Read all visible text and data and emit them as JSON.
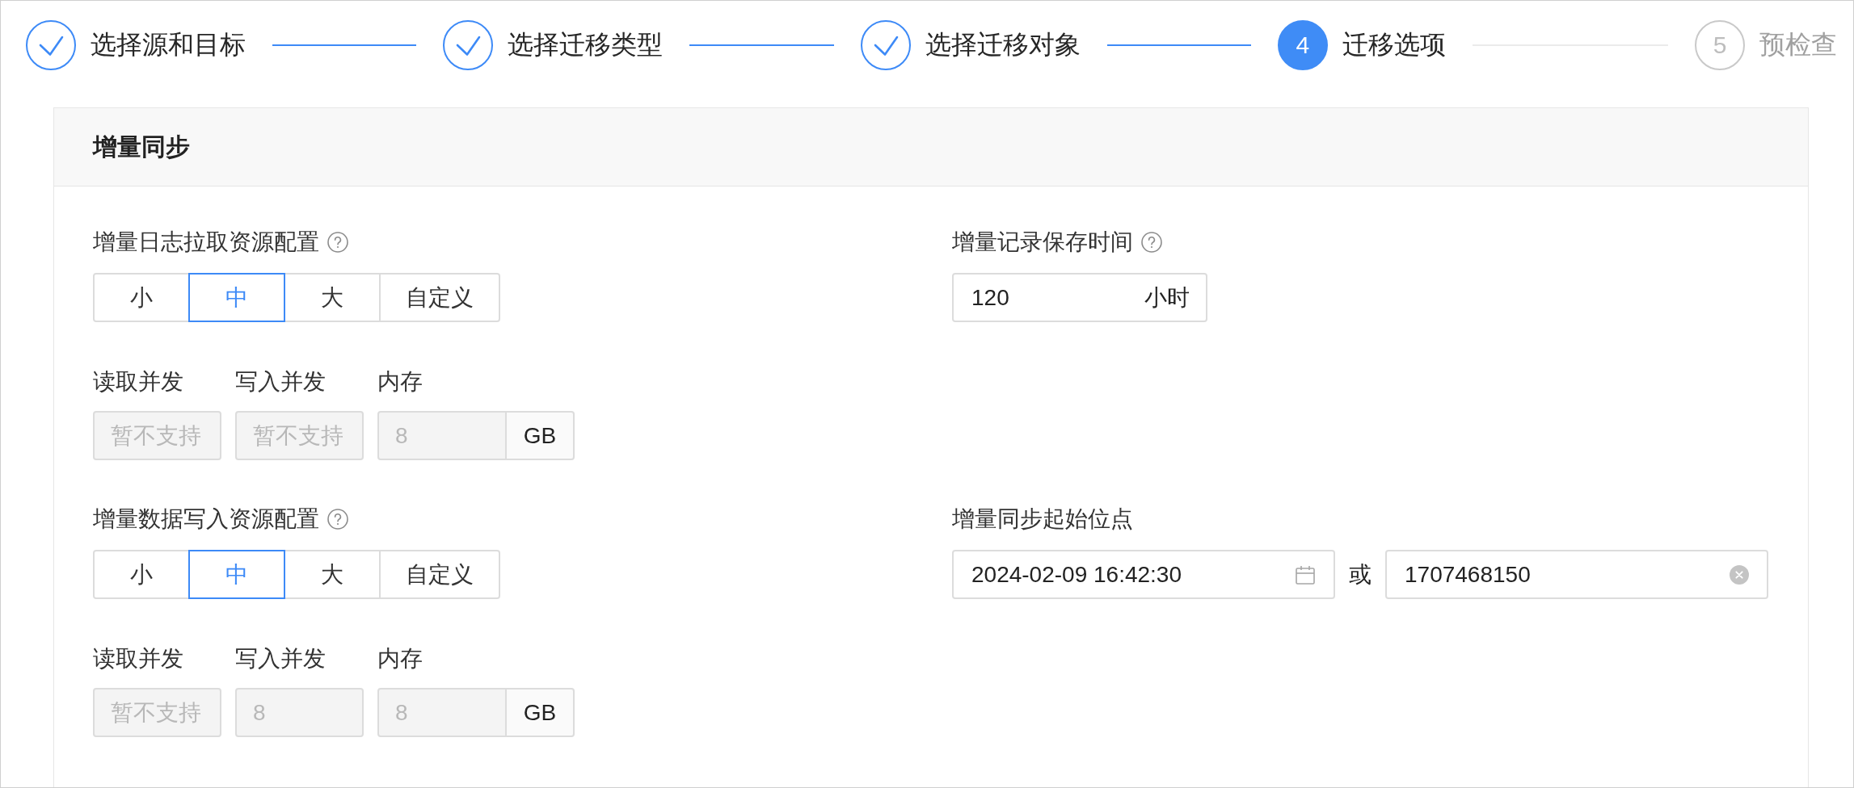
{
  "steps": [
    {
      "label": "选择源和目标",
      "done": true,
      "current": false
    },
    {
      "label": "选择迁移类型",
      "done": true,
      "current": false
    },
    {
      "label": "选择迁移对象",
      "done": true,
      "current": false
    },
    {
      "number": "4",
      "label": "迁移选项",
      "done": false,
      "current": true
    },
    {
      "number": "5",
      "label": "预检查",
      "done": false,
      "current": false
    }
  ],
  "panel": {
    "title": "增量同步",
    "rows": [
      {
        "resource_config": {
          "label": "增量日志拉取资源配置",
          "help": true,
          "options": [
            {
              "label": "小",
              "selected": false
            },
            {
              "label": "中",
              "selected": true
            },
            {
              "label": "大",
              "selected": false
            },
            {
              "label": "自定义",
              "selected": false
            }
          ],
          "fields": [
            {
              "label": "读取并发",
              "placeholder": "暂不支持",
              "disabled": true
            },
            {
              "label": "写入并发",
              "placeholder": "暂不支持",
              "disabled": true
            },
            {
              "label": "内存",
              "value": "8",
              "unit": "GB",
              "disabled": true
            }
          ]
        },
        "side_setting": {
          "kind": "duration",
          "label": "增量记录保存时间",
          "help": true,
          "value": "120",
          "unit": "小时"
        }
      },
      {
        "resource_config": {
          "label": "增量数据写入资源配置",
          "help": true,
          "options": [
            {
              "label": "小",
              "selected": false
            },
            {
              "label": "中",
              "selected": true
            },
            {
              "label": "大",
              "selected": false
            },
            {
              "label": "自定义",
              "selected": false
            }
          ],
          "fields": [
            {
              "label": "读取并发",
              "placeholder": "暂不支持",
              "disabled": true
            },
            {
              "label": "写入并发",
              "value": "8",
              "disabled": true
            },
            {
              "label": "内存",
              "value": "8",
              "unit": "GB",
              "disabled": true
            }
          ]
        },
        "side_setting": {
          "kind": "start_position",
          "label": "增量同步起始位点",
          "datetime": "2024-02-09 16:42:30",
          "separator": "或",
          "timestamp": "1707468150"
        }
      }
    ]
  }
}
